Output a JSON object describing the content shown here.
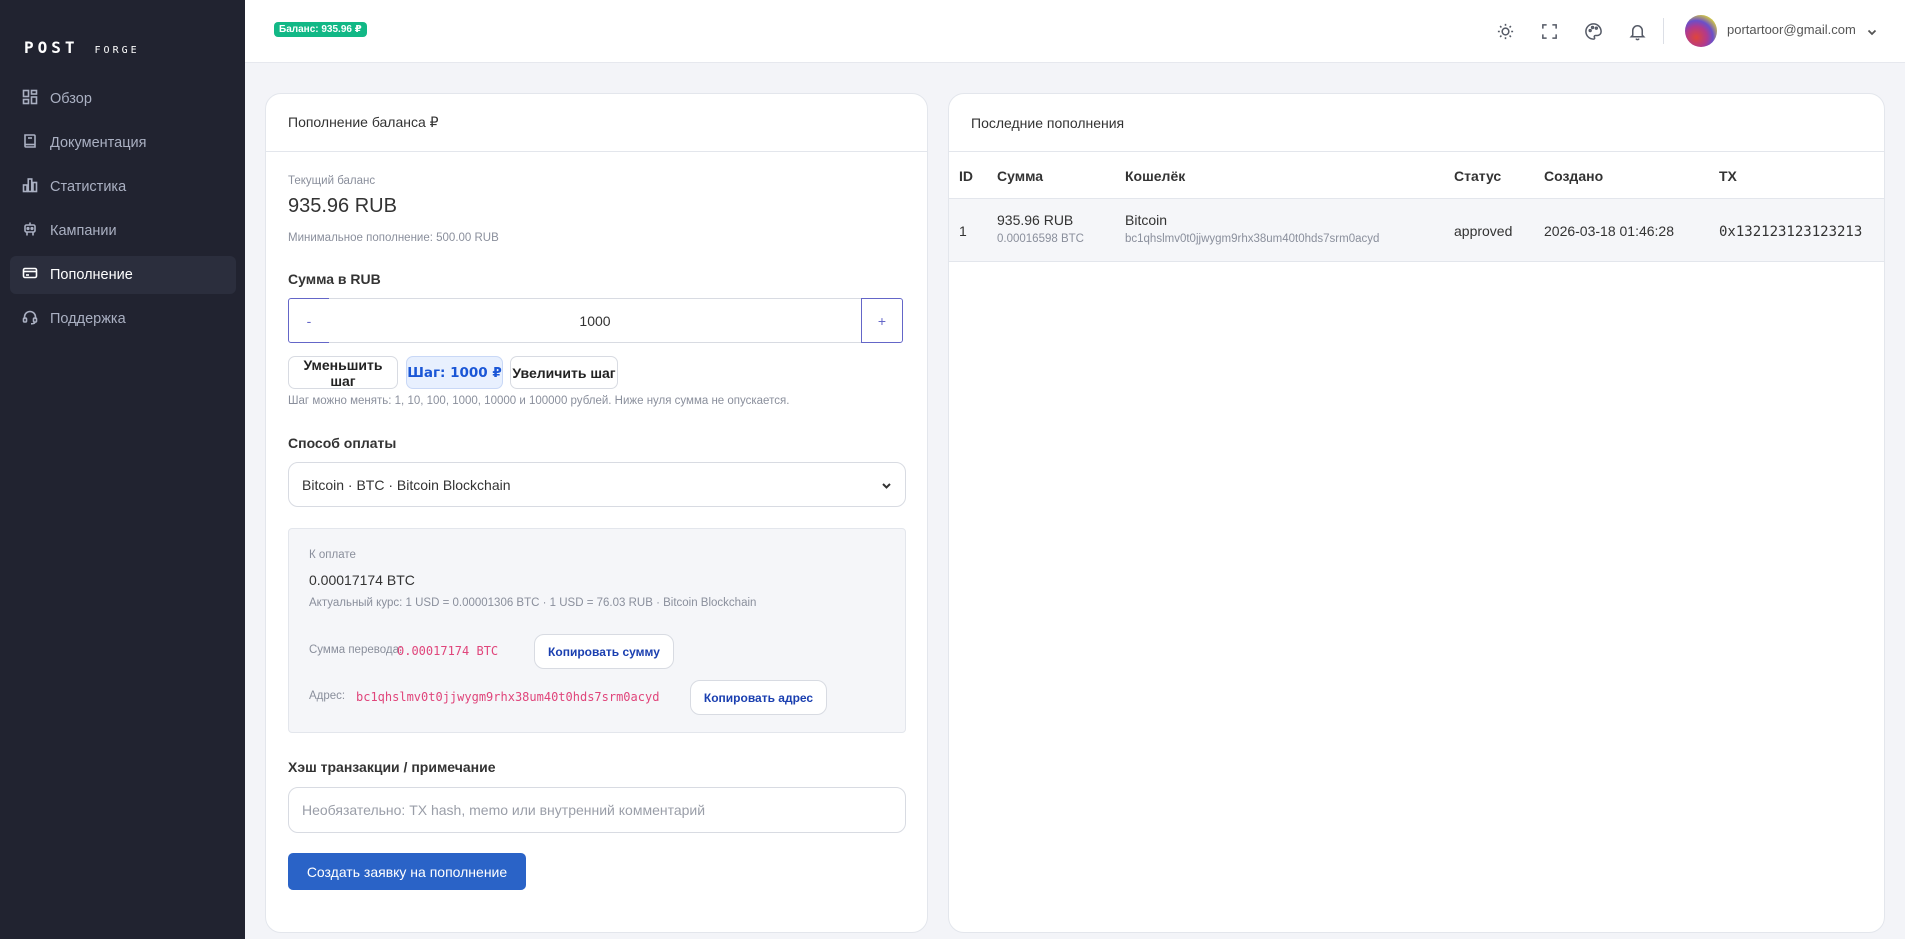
{
  "sidebar": {
    "logo_main": "POST",
    "logo_sub": "FORGE",
    "items": [
      {
        "label": "Обзор",
        "icon": "dashboard-icon"
      },
      {
        "label": "Документация",
        "icon": "book-icon"
      },
      {
        "label": "Статистика",
        "icon": "bar-chart-icon"
      },
      {
        "label": "Кампании",
        "icon": "robot-icon"
      },
      {
        "label": "Пополнение",
        "icon": "credit-card-icon",
        "active": true
      },
      {
        "label": "Поддержка",
        "icon": "headset-icon"
      }
    ]
  },
  "header": {
    "balance_badge": "Баланс: 935.96 ₽",
    "icons": [
      "sun-icon",
      "fullscreen-icon",
      "palette-icon",
      "bell-icon"
    ],
    "user_email": "portartoor@gmail.com"
  },
  "topup": {
    "title": "Пополнение баланса ₽",
    "current_balance_label": "Текущий баланс",
    "current_balance": "935.96 RUB",
    "min_topup": "Минимальное пополнение: 500.00 RUB",
    "amount_label": "Сумма в RUB",
    "minus": "-",
    "plus": "+",
    "amount_value": "1000",
    "decrease_step": "Уменьшить шаг",
    "step": "Шаг: 1000 ₽",
    "increase_step": "Увеличить шаг",
    "step_hint": "Шаг можно менять: 1, 10, 100, 1000, 10000 и 100000 рублей. Ниже нуля сумма не опускается.",
    "method_label": "Способ оплаты",
    "method_value": "Bitcoin · BTC · Bitcoin Blockchain",
    "pay": {
      "to_pay_label": "К оплате",
      "to_pay_value": "0.00017174 BTC",
      "rate": "Актуальный курс: 1 USD = 0.00001306 BTC · 1 USD = 76.03 RUB · Bitcoin Blockchain",
      "transfer_label": "Сумма перевода:",
      "transfer_value": "0.00017174 BTC",
      "copy_amount": "Копировать сумму",
      "address_label": "Адрес:",
      "address_value": "bc1qhslmv0t0jjwygm9rhx38um40t0hds7srm0acyd",
      "copy_address": "Копировать адрес"
    },
    "hash_label": "Хэш транзакции / примечание",
    "hash_placeholder": "Необязательно: TX hash, memo или внутренний комментарий",
    "submit": "Создать заявку на пополнение"
  },
  "recent": {
    "title": "Последние пополнения",
    "columns": [
      "ID",
      "Сумма",
      "Кошелёк",
      "Статус",
      "Создано",
      "TX"
    ],
    "rows": [
      {
        "id": "1",
        "amount": "935.96 RUB",
        "amount_btc": "0.00016598 BTC",
        "wallet": "Bitcoin",
        "wallet_address": "bc1qhslmv0t0jjwygm9rhx38um40t0hds7srm0acyd",
        "status": "approved",
        "created": "2026-03-18 01:46:28",
        "tx": "0x132123123123213"
      }
    ]
  },
  "colors": {
    "sidebar_bg": "#212330",
    "badge_green": "#12b886",
    "primary_blue": "#2a63c7",
    "accent_pink": "#e0457b",
    "stepper_border": "#6466c8"
  }
}
